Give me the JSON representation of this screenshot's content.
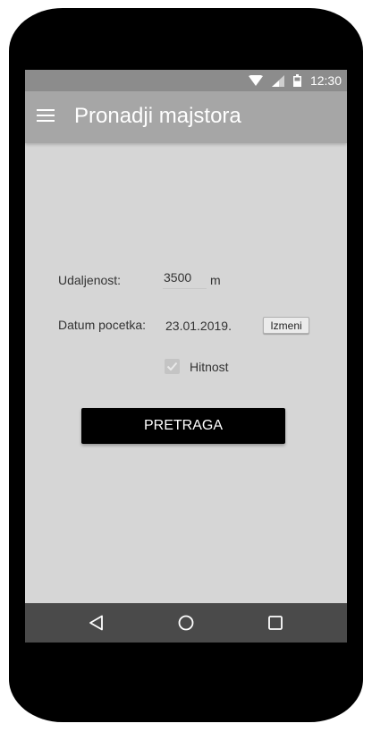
{
  "status_bar": {
    "time": "12:30",
    "icons": [
      "wifi-icon",
      "signal-icon",
      "battery-icon"
    ]
  },
  "app_bar": {
    "title": "Pronadji majstora",
    "menu_icon": "hamburger-menu-icon"
  },
  "form": {
    "distance_label": "Udaljenost:",
    "distance_value": "3500",
    "distance_unit": "m",
    "date_label": "Datum pocetka:",
    "date_value": "23.01.2019.",
    "edit_button_label": "Izmeni",
    "urgent_label": "Hitnost",
    "urgent_checked": true
  },
  "search_button_label": "PRETRAGA",
  "nav_bar": {
    "icons": [
      "back-icon",
      "home-icon",
      "recents-icon"
    ]
  },
  "colors": {
    "status_bar": "#8c8c8c",
    "app_bar": "#a6a6a6",
    "screen_background": "#d6d6d6",
    "primary_button": "#000000",
    "nav_bar": "#4a4a4a",
    "device_frame": "#000000"
  }
}
